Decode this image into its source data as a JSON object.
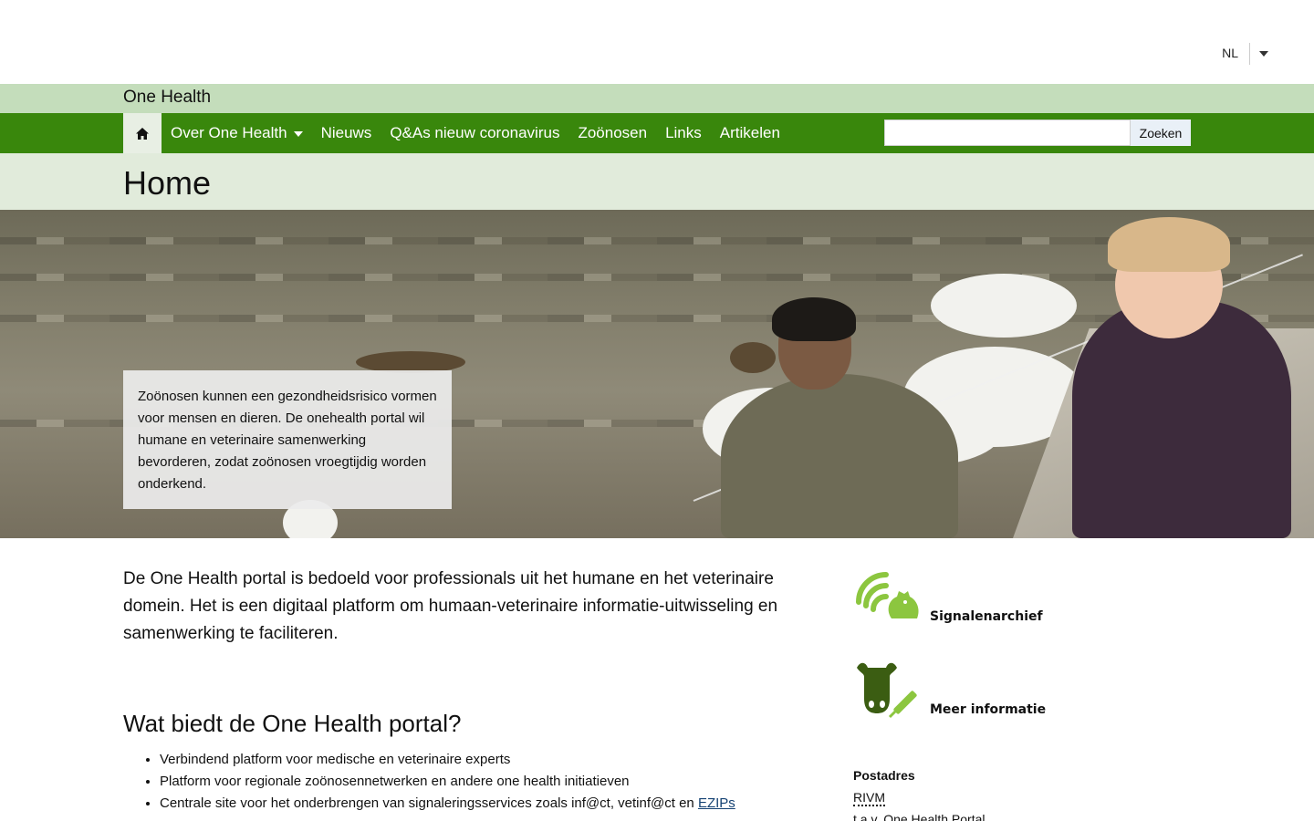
{
  "header": {
    "lang": "NL",
    "site_title": "One Health"
  },
  "nav": {
    "items": [
      {
        "label": "Over One Health",
        "has_menu": true
      },
      {
        "label": "Nieuws"
      },
      {
        "label": "Q&As nieuw coronavirus"
      },
      {
        "label": "Zoönosen"
      },
      {
        "label": "Links"
      },
      {
        "label": "Artikelen"
      }
    ],
    "search_placeholder": "",
    "search_button": "Zoeken"
  },
  "page": {
    "title": "Home"
  },
  "hero": {
    "text": "Zoönosen kunnen een gezondheidsrisico vormen voor mensen en dieren. De onehealth portal wil humane en veterinaire samenwerking bevorderen, zodat zoönosen vroegtijdig worden onderkend."
  },
  "main": {
    "lead": "De One Health portal is bedoeld voor professionals uit het humane en het veterinaire domein. Het is een digitaal platform om humaan-veterinaire informatie-uitwisseling en samenwerking te faciliteren.",
    "heading": "Wat biedt de One Health portal?",
    "bullets": [
      "Verbindend platform voor medische en veterinaire experts",
      "Platform voor regionale zoönosennetwerken en andere one health initiatieven"
    ],
    "bullet3_text": "Centrale site voor het onderbrengen van signaleringsservices zoals inf@ct, vetinf@ct en",
    "bullet3_link": "EZIPs"
  },
  "aside": {
    "tile1": "Signalenarchief",
    "tile2": "Meer informatie",
    "postadres_heading": "Postadres",
    "org": "RIVM",
    "tav": "t.a.v. One Health Portal"
  },
  "colors": {
    "nav_green": "#39870c",
    "light_green": "#c4ddbb",
    "icon_green": "#8cc63f",
    "icon_dark": "#3b5d12"
  }
}
